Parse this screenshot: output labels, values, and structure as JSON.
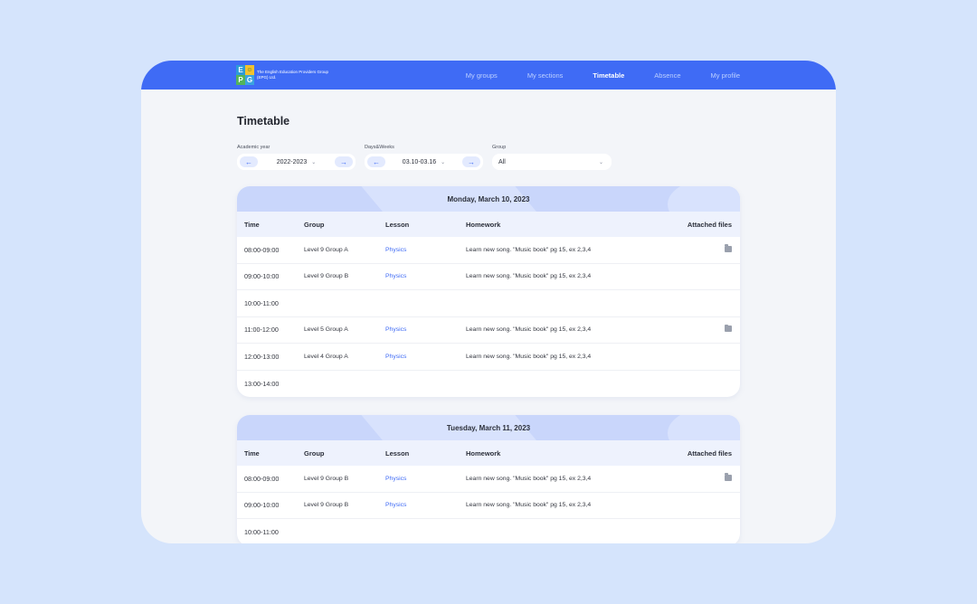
{
  "header": {
    "logo_letters": [
      "E",
      "",
      "P",
      "G"
    ],
    "logo_text": "The English Education Providers Group (EPG) Ltd.",
    "nav": [
      {
        "label": "My groups"
      },
      {
        "label": "My sections"
      },
      {
        "label": "Timetable"
      },
      {
        "label": "Absence"
      },
      {
        "label": "My profile"
      }
    ],
    "active_nav": "Timetable"
  },
  "page": {
    "title": "Timetable"
  },
  "filters": {
    "academic_year": {
      "label": "Academic year",
      "value": "2022-2023"
    },
    "days_weeks": {
      "label": "Days&Weeks",
      "value": "03.10-03.16"
    },
    "group": {
      "label": "Group",
      "value": "All"
    }
  },
  "columns": {
    "time": "Time",
    "group": "Group",
    "lesson": "Lesson",
    "homework": "Homework",
    "files": "Attached files"
  },
  "days": [
    {
      "title": "Monday, March 10, 2023",
      "rows": [
        {
          "time": "08:00-09:00",
          "group": "Level 9 Group A",
          "lesson": "Physics",
          "homework": "Learn new song. \"Music book\" pg 15, ex 2,3,4",
          "file": true
        },
        {
          "time": "09:00-10:00",
          "group": "Level 9 Group B",
          "lesson": "Physics",
          "homework": "Learn new song. \"Music book\" pg 15, ex 2,3,4",
          "file": false
        },
        {
          "time": "10:00-11:00",
          "group": "",
          "lesson": "",
          "homework": "",
          "file": false
        },
        {
          "time": "11:00-12:00",
          "group": "Level 5 Group A",
          "lesson": "Physics",
          "homework": "Learn new song. \"Music book\" pg 15, ex 2,3,4",
          "file": true
        },
        {
          "time": "12:00-13:00",
          "group": "Level 4 Group A",
          "lesson": "Physics",
          "homework": "Learn new song. \"Music book\" pg 15, ex 2,3,4",
          "file": false
        },
        {
          "time": "13:00-14:00",
          "group": "",
          "lesson": "",
          "homework": "",
          "file": false
        }
      ]
    },
    {
      "title": "Tuesday, March 11, 2023",
      "rows": [
        {
          "time": "08:00-09:00",
          "group": "Level 9 Group B",
          "lesson": "Physics",
          "homework": "Learn new song. \"Music book\" pg 15, ex 2,3,4",
          "file": true
        },
        {
          "time": "09:00-10:00",
          "group": "Level 9 Group B",
          "lesson": "Physics",
          "homework": "Learn new song. \"Music book\" pg 15, ex 2,3,4",
          "file": false
        },
        {
          "time": "10:00-11:00",
          "group": "",
          "lesson": "",
          "homework": "",
          "file": false
        }
      ]
    }
  ],
  "icons": {
    "prev": "arrow-left-icon",
    "next": "arrow-right-icon",
    "dropdown": "chevron-down-icon",
    "file": "folder-icon"
  },
  "colors": {
    "accent": "#3f6bf5",
    "background": "#d5e4fc",
    "day_header": "#c9d6fb"
  }
}
